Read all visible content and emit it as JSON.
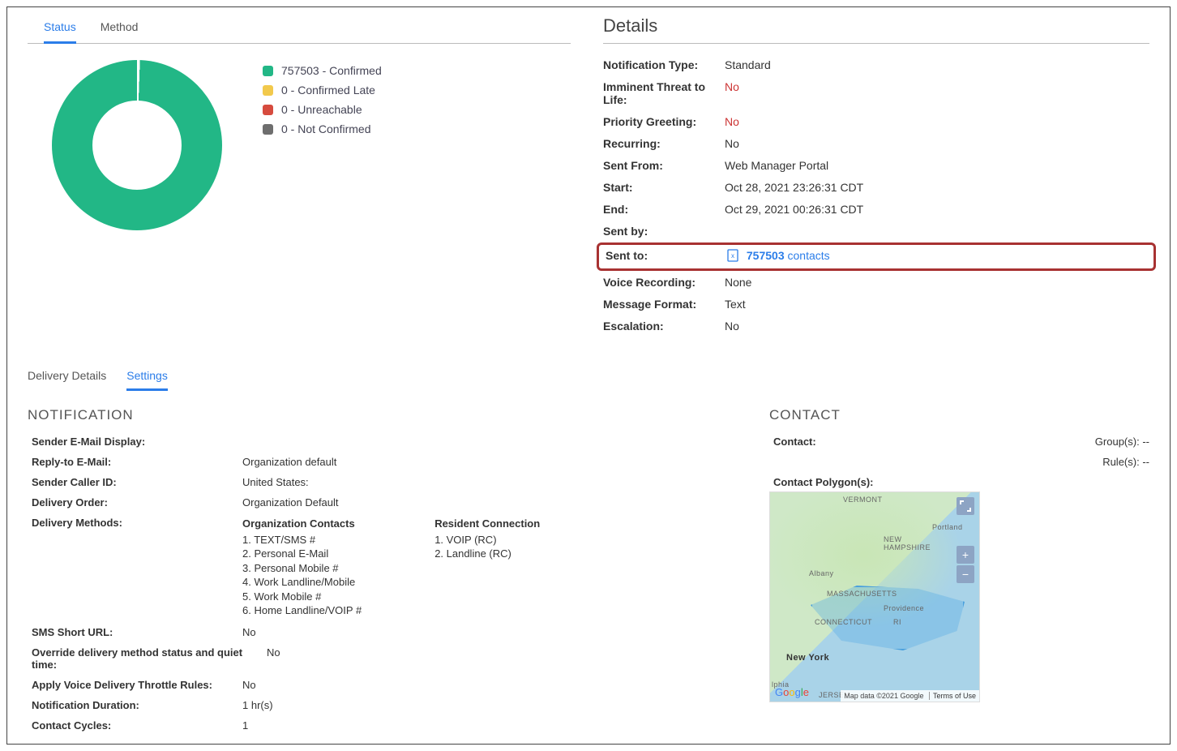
{
  "tabs_top": {
    "status": "Status",
    "method": "Method"
  },
  "chart_data": {
    "type": "pie",
    "categories": [
      "Confirmed",
      "Confirmed Late",
      "Unreachable",
      "Not Confirmed"
    ],
    "values": [
      757503,
      0,
      0,
      0
    ],
    "colors": [
      "#22b786",
      "#f2c94c",
      "#d64b3e",
      "#6e6e6e"
    ]
  },
  "legend": {
    "confirmed": "757503 - Confirmed",
    "confirmed_late": "0 - Confirmed Late",
    "unreachable": "0 - Unreachable",
    "not_confirmed": "0 - Not Confirmed"
  },
  "details": {
    "title": "Details",
    "labels": {
      "notification_type": "Notification Type:",
      "imminent": "Imminent Threat to Life:",
      "priority": "Priority Greeting:",
      "recurring": "Recurring:",
      "sent_from": "Sent From:",
      "start": "Start:",
      "end": "End:",
      "sent_by": "Sent by:",
      "sent_to": "Sent to:",
      "voice": "Voice Recording:",
      "format": "Message Format:",
      "escalation": "Escalation:"
    },
    "values": {
      "notification_type": "Standard",
      "imminent": "No",
      "priority": "No",
      "recurring": "No",
      "sent_from": "Web Manager Portal",
      "start": "Oct 28, 2021 23:26:31 CDT",
      "end": "Oct 29, 2021 00:26:31 CDT",
      "sent_by": "",
      "sent_to_count": "757503",
      "sent_to_word": "contacts",
      "voice": "None",
      "format": "Text",
      "escalation": "No"
    }
  },
  "tabs_low": {
    "delivery": "Delivery Details",
    "settings": "Settings"
  },
  "notification": {
    "title": "NOTIFICATION",
    "labels": {
      "sender_email": "Sender E-Mail Display:",
      "reply_to": "Reply-to E-Mail:",
      "caller_id": "Sender Caller ID:",
      "delivery_order": "Delivery Order:",
      "delivery_methods": "Delivery Methods:",
      "sms_short": "SMS Short URL:",
      "override": "Override delivery method status and quiet time:",
      "throttle": "Apply Voice Delivery Throttle Rules:",
      "duration": "Notification Duration:",
      "cycles": "Contact Cycles:"
    },
    "values": {
      "sender_email": "",
      "reply_to": "Organization default",
      "caller_id": "United States:",
      "delivery_order": "Organization Default",
      "sms_short": "No",
      "override": "No",
      "throttle": "No",
      "duration": "1 hr(s)",
      "cycles": "1"
    },
    "org_contacts": {
      "header": "Organization Contacts",
      "items": {
        "i1": "1. TEXT/SMS #",
        "i2": "2. Personal E-Mail",
        "i3": "3. Personal Mobile #",
        "i4": "4. Work Landline/Mobile",
        "i5": "5. Work Mobile #",
        "i6": "6. Home Landline/VOIP #"
      }
    },
    "resident": {
      "header": "Resident Connection",
      "items": {
        "i1": "1. VOIP (RC)",
        "i2": "2. Landline (RC)"
      }
    }
  },
  "contact": {
    "title": "CONTACT",
    "contact_label": "Contact:",
    "groups_label": "Group(s):",
    "groups_value": "--",
    "rules_label": "Rule(s):",
    "rules_value": "--",
    "polygon_label": "Contact Polygon(s):"
  },
  "map": {
    "attribution": "Map data ©2021 Google",
    "terms": "Terms of Use",
    "places": {
      "vermont": "VERMONT",
      "nh": "NEW\nHAMPSHIRE",
      "portland": "Portland",
      "albany": "Albany",
      "ma": "MASSACHUSETTS",
      "providence": "Providence",
      "ct": "CONNECTICUT",
      "ri": "RI",
      "ny": "New York",
      "phila": "lphia",
      "nj": "JERSEY"
    }
  }
}
